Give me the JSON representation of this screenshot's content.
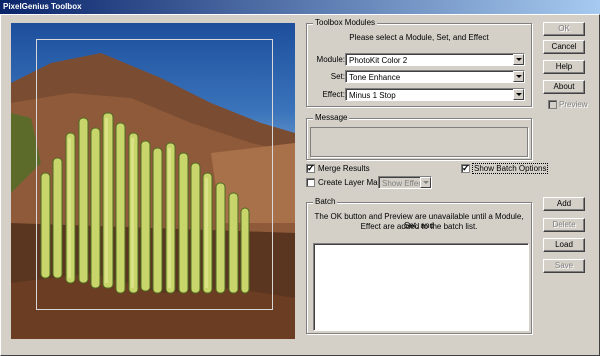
{
  "window": {
    "title": "PixelGenius Toolbox"
  },
  "toolbox": {
    "group_label": "Toolbox Modules",
    "instruction": "Please select a Module, Set, and Effect",
    "module_label": "Module:",
    "module_value": "PhotoKit Color 2",
    "set_label": "Set:",
    "set_value": "Tone Enhance",
    "effect_label": "Effect:",
    "effect_value": "Minus 1 Stop"
  },
  "message": {
    "group_label": "Message"
  },
  "options": {
    "merge_results": "Merge Results",
    "show_batch_options": "Show Batch Options",
    "create_layer_mask": "Create Layer Mask:",
    "show_effect": "Show Effect"
  },
  "batch": {
    "group_label": "Batch",
    "info_line1": "The OK button and Preview are unavailable until a Module, Set, and",
    "info_line2": "Effect are added to the batch list."
  },
  "buttons": {
    "ok": "OK",
    "cancel": "Cancel",
    "help": "Help",
    "about": "About",
    "preview": "Preview",
    "add": "Add",
    "delete": "Delete",
    "load": "Load",
    "save": "Save"
  }
}
